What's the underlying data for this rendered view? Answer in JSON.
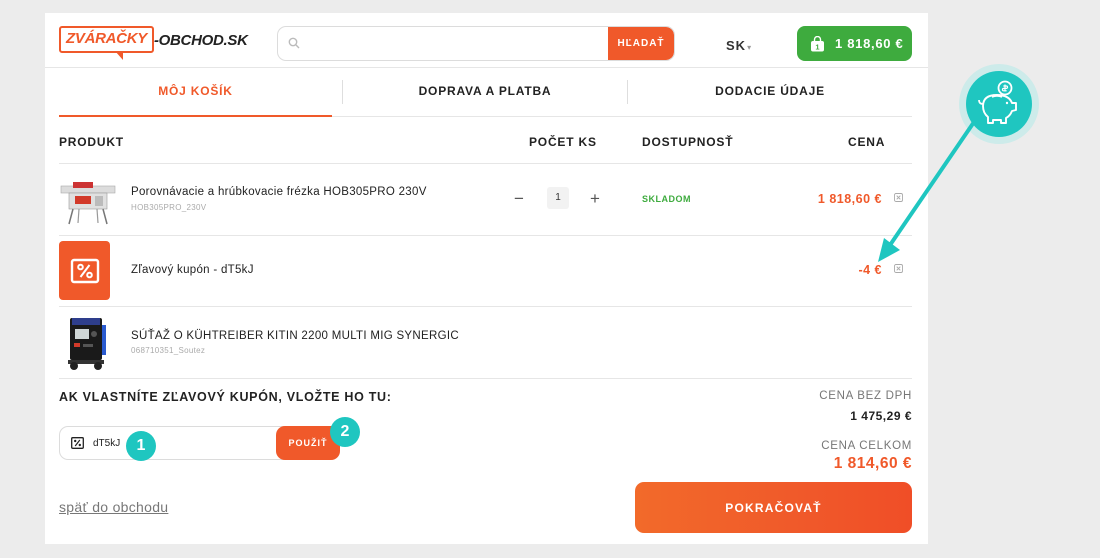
{
  "header": {
    "logo_main": "ZVÁRAČKY",
    "logo_rest": "-OBCHOD",
    "logo_tld": ".SK",
    "search_placeholder": "",
    "search_button": "HĽADAŤ",
    "language": "SK",
    "cart_total": "1 818,60 €",
    "cart_count": "1"
  },
  "steps": [
    {
      "label": "MÔJ KOŠÍK",
      "active": true
    },
    {
      "label": "DOPRAVA A PLATBA",
      "active": false
    },
    {
      "label": "DODACIE ÚDAJE",
      "active": false
    }
  ],
  "table": {
    "headers": {
      "product": "PRODUKT",
      "qty": "POČET KS",
      "availability": "DOSTUPNOSŤ",
      "price": "CENA"
    }
  },
  "items": [
    {
      "name": "Porovnávacie a hrúbkovacie frézka HOB305PRO 230V",
      "code": "HOB305PRO_230V",
      "qty": "1",
      "availability": "SKLADOM",
      "price": "1 818,60 €"
    },
    {
      "name": "Zľavový kupón - dT5kJ",
      "price": "-4 €"
    },
    {
      "name": "SÚŤAŽ O KÜHTREIBER KITIN 2200 MULTI MIG SYNERGIC",
      "code": "068710351_Soutez"
    }
  ],
  "qty_controls": {
    "minus": "−",
    "plus": "+"
  },
  "coupon": {
    "title": "AK VLASTNÍTE ZĽAVOVÝ KUPÓN, VLOŽTE HO TU:",
    "value": "dT5kJ",
    "apply_button": "POUŽIŤ",
    "badge_1": "1",
    "badge_2": "2"
  },
  "totals": {
    "without_vat_label": "CENA BEZ DPH",
    "without_vat_value": "1 475,29 €",
    "total_label": "CENA CELKOM",
    "total_value": "1 814,60 €"
  },
  "footer": {
    "back_link": "späť do obchodu",
    "continue_button": "POKRAČOVAŤ"
  },
  "colors": {
    "accent": "#f0592a",
    "green": "#3eab3e",
    "teal": "#1fc6c0"
  },
  "icons": [
    "search-icon",
    "shopping-bag-icon",
    "percent-icon",
    "remove-icon",
    "piggy-bank-icon"
  ]
}
